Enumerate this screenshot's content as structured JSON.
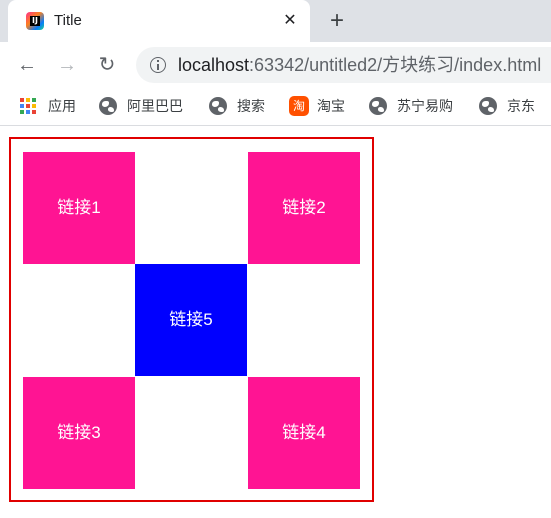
{
  "browser": {
    "tab": {
      "title": "Title",
      "close_glyph": "✕",
      "favicon": "intellij-icon"
    },
    "new_tab_glyph": "+",
    "nav": {
      "back": "←",
      "forward": "→",
      "reload": "↻"
    },
    "address": {
      "host": "localhost",
      "path": ":63342/untitled2/方块练习/index.html",
      "security_icon": "info-icon"
    },
    "bookmarks": [
      {
        "label": "应用",
        "icon": "apps-icon"
      },
      {
        "label": "阿里巴巴",
        "icon": "globe-icon"
      },
      {
        "label": "搜索",
        "icon": "globe-icon"
      },
      {
        "label": "淘宝",
        "icon": "taobao-icon"
      },
      {
        "label": "苏宁易购",
        "icon": "globe-icon"
      },
      {
        "label": "京东",
        "icon": "globe-icon"
      }
    ],
    "taobao_glyph": "淘"
  },
  "page": {
    "links": [
      {
        "label": "链接1",
        "color": "#ff1493"
      },
      {
        "label": "链接2",
        "color": "#ff1493"
      },
      {
        "label": "链接3",
        "color": "#ff1493"
      },
      {
        "label": "链接4",
        "color": "#ff1493"
      },
      {
        "label": "链接5",
        "color": "#0000ff"
      }
    ],
    "border_color": "#e00000"
  },
  "colors": {
    "tabstrip": "#dee1e6",
    "omnibox": "#f1f3f4",
    "apps_dots": [
      "#ea4335",
      "#fbbc04",
      "#34a853",
      "#4285f4",
      "#ea4335",
      "#fbbc04",
      "#34a853",
      "#4285f4",
      "#ea4335"
    ]
  }
}
